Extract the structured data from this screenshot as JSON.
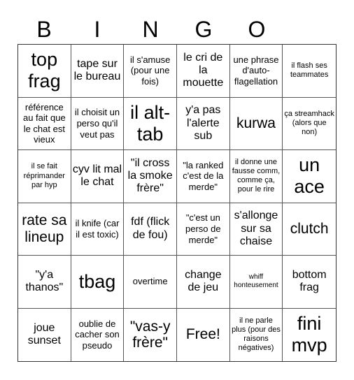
{
  "header": {
    "letters": [
      "B",
      "I",
      "N",
      "G",
      "O"
    ]
  },
  "card": {
    "rows": [
      [
        {
          "text": "top frag",
          "size": "s-xl"
        },
        {
          "text": "tape sur le bureau",
          "size": "s-m"
        },
        {
          "text": "il s'amuse (pour une fois)",
          "size": "s-s"
        },
        {
          "text": "le cri de la mouette",
          "size": "s-m"
        },
        {
          "text": "une phrase d'auto-flagellation",
          "size": "s-s"
        },
        {
          "text": "il flash ses teammates",
          "size": "s-xs"
        }
      ],
      [
        {
          "text": "référence au fait que le chat est vieux",
          "size": "s-s"
        },
        {
          "text": "il choisit un perso qu'il veut pas",
          "size": "s-s"
        },
        {
          "text": "il alt-tab",
          "size": "s-xl"
        },
        {
          "text": "y'a pas l'alerte sub",
          "size": "s-m"
        },
        {
          "text": "kurwa",
          "size": "s-l"
        },
        {
          "text": "ça streamhack (alors que non)",
          "size": "s-xs"
        }
      ],
      [
        {
          "text": "il se fait réprimander par hyp",
          "size": "s-xs"
        },
        {
          "text": "cyv lit mal le chat",
          "size": "s-m"
        },
        {
          "text": "\"il cross la smoke frère\"",
          "size": "s-m"
        },
        {
          "text": "\"la ranked c'est de la merde\"",
          "size": "s-s"
        },
        {
          "text": "il donne une fausse comm, comme ça, pour le rire",
          "size": "s-xs"
        },
        {
          "text": "un ace",
          "size": "s-xl"
        }
      ],
      [
        {
          "text": "rate sa lineup",
          "size": "s-l"
        },
        {
          "text": "il knife (car il est toxic)",
          "size": "s-s"
        },
        {
          "text": "fdf (flick de fou)",
          "size": "s-m"
        },
        {
          "text": "\"c'est un perso de merde\"",
          "size": "s-s"
        },
        {
          "text": "s'allonge sur sa chaise",
          "size": "s-m"
        },
        {
          "text": "clutch",
          "size": "s-l"
        }
      ],
      [
        {
          "text": "\"y'a thanos\"",
          "size": "s-m"
        },
        {
          "text": "tbag",
          "size": "s-xl"
        },
        {
          "text": "overtime",
          "size": "s-s"
        },
        {
          "text": "change de jeu",
          "size": "s-m"
        },
        {
          "text": "whiff honteusement",
          "size": "s-xxs"
        },
        {
          "text": "bottom frag",
          "size": "s-m"
        }
      ],
      [
        {
          "text": "joue sunset",
          "size": "s-m"
        },
        {
          "text": "oublie de cacher son pseudo",
          "size": "s-s"
        },
        {
          "text": "\"vas-y frère\"",
          "size": "s-l"
        },
        {
          "text": "Free!",
          "size": "s-l"
        },
        {
          "text": "il ne parle plus (pour des raisons négatives)",
          "size": "s-xs"
        },
        {
          "text": "fini mvp",
          "size": "s-xl"
        }
      ]
    ]
  }
}
